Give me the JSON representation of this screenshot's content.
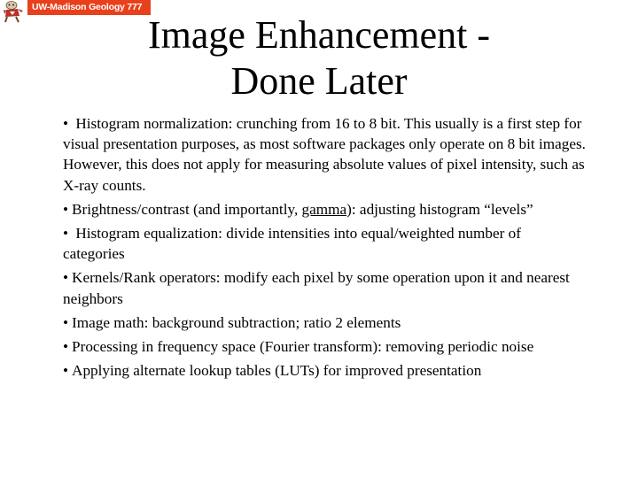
{
  "header": {
    "logo_icon": "badger-mascot-icon",
    "banner_text": "UW-Madison Geology  777",
    "banner_color": "#e8401c"
  },
  "slide": {
    "title_line1": "Image Enhancement -",
    "title_line2": "Done Later",
    "bullet_glyph": "•",
    "items": [
      {
        "text": " Histogram normalization: crunching from 16 to 8 bit. This usually is a first step for visual presentation purposes, as most software packages only operate on 8 bit images. However, this does not apply for measuring absolute values of pixel intensity, such as X-ray counts."
      },
      {
        "text_before": "Brightness/contrast (and importantly, ",
        "link_text": "gamma",
        "text_after": "): adjusting histogram “levels”"
      },
      {
        "text": " Histogram equalization: divide intensities into equal/weighted number of categories"
      },
      {
        "text": "Kernels/Rank operators: modify each pixel by some operation upon it and nearest neighbors"
      },
      {
        "text": "Image math: background subtraction; ratio 2 elements"
      },
      {
        "text": "Processing in frequency space (Fourier transform): removing periodic noise"
      },
      {
        "text": "Applying alternate lookup tables (LUTs) for improved presentation"
      }
    ]
  }
}
